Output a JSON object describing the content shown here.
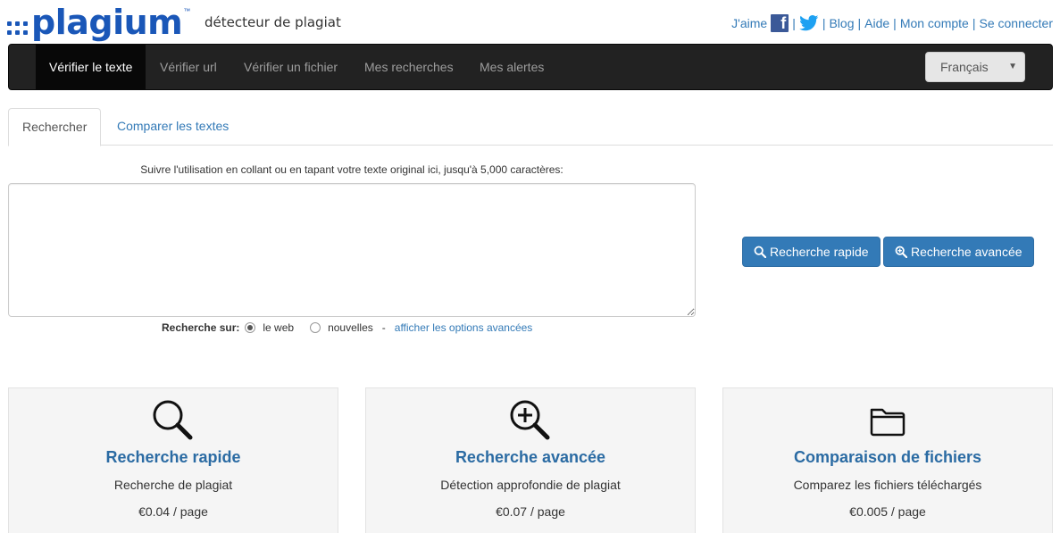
{
  "header": {
    "logo_text": "plagium",
    "logo_tm": "™",
    "tagline": "détecteur de plagiat",
    "links": {
      "like": "J'aime",
      "blog": "Blog",
      "help": "Aide",
      "account": "Mon compte",
      "login": "Se connecter",
      "separator": "|"
    }
  },
  "navbar": {
    "items": [
      {
        "label": "Vérifier le texte",
        "active": true
      },
      {
        "label": "Vérifier url"
      },
      {
        "label": "Vérifier un fichier"
      },
      {
        "label": "Mes recherches"
      },
      {
        "label": "Mes alertes"
      }
    ],
    "language": "Français"
  },
  "tabs": [
    {
      "label": "Rechercher",
      "active": true
    },
    {
      "label": "Comparer les textes"
    }
  ],
  "form": {
    "instructions": "Suivre l'utilisation en collant ou en tapant votre texte original ici, jusqu'à 5,000 caractères:",
    "textarea_value": "",
    "search_on_label": "Recherche sur:",
    "option_web": "le web",
    "option_news": "nouvelles",
    "dash": "-",
    "advanced_link": "afficher les options avancées",
    "selected_option": "le web"
  },
  "buttons": {
    "quick": "Recherche rapide",
    "advanced": "Recherche avancée"
  },
  "cards": [
    {
      "title": "Recherche rapide",
      "desc": "Recherche de plagiat",
      "price": "€0.04 / page",
      "icon": "magnifier-icon"
    },
    {
      "title": "Recherche avancée",
      "desc": "Détection approfondie de plagiat",
      "price": "€0.07 / page",
      "icon": "zoom-in-icon"
    },
    {
      "title": "Comparaison de fichiers",
      "desc": "Comparez les fichiers téléchargés",
      "price": "€0.005 / page",
      "icon": "folder-icon"
    }
  ],
  "colors": {
    "brand": "#1a57b8",
    "link": "#337ab7",
    "navbar": "#222222",
    "button": "#337ab7"
  }
}
